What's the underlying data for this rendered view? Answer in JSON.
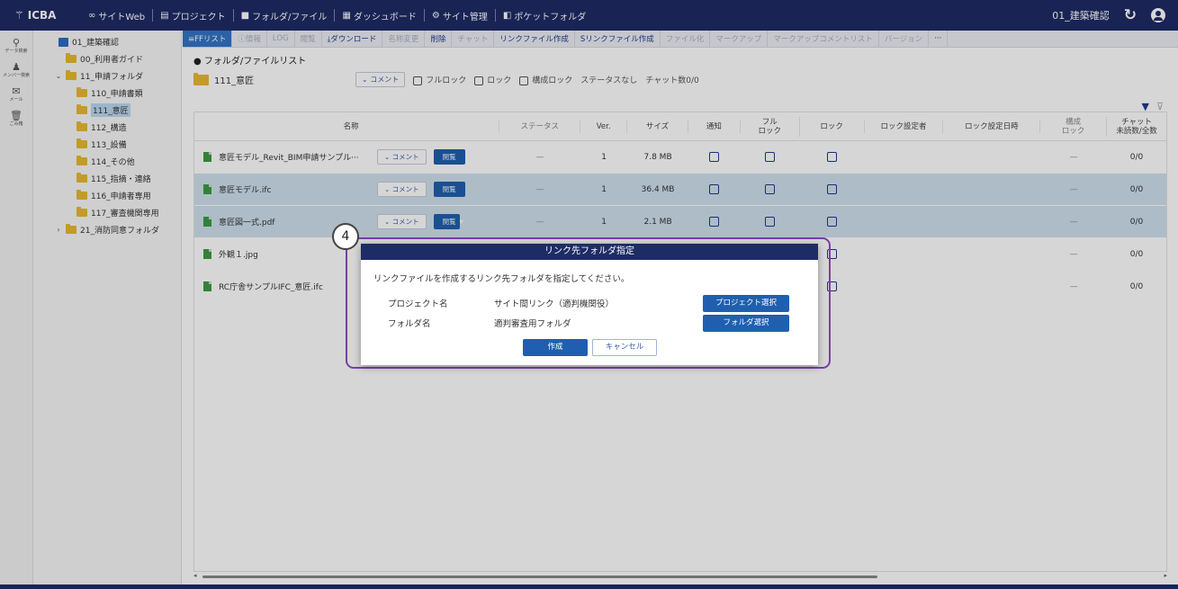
{
  "app": {
    "brand": "ICBA",
    "nav": [
      {
        "icon": "link-icon",
        "label": "サイトWeb"
      },
      {
        "icon": "project-icon",
        "label": "プロジェクト"
      },
      {
        "icon": "folder-icon",
        "label": "フォルダ/ファイル"
      },
      {
        "icon": "dashboard-icon",
        "label": "ダッシュボード"
      },
      {
        "icon": "gear-icon",
        "label": "サイト管理"
      },
      {
        "icon": "pocket-icon",
        "label": "ポケットフォルダ"
      }
    ],
    "current_project": "01_建築確認"
  },
  "rail": [
    {
      "icon": "data-search-icon",
      "label": "データ検索"
    },
    {
      "icon": "member-search-icon",
      "label": "メンバー検索"
    },
    {
      "icon": "mail-icon",
      "label": "メール"
    },
    {
      "icon": "trash-icon",
      "label": "ごみ箱"
    }
  ],
  "tree": {
    "root": "01_建築確認",
    "items": [
      {
        "label": "00_利用者ガイド",
        "level": 1,
        "caret": ""
      },
      {
        "label": "11_申請フォルダ",
        "level": 1,
        "caret": "⌄"
      },
      {
        "label": "110_申請書類",
        "level": 2,
        "caret": ""
      },
      {
        "label": "111_意匠",
        "level": 2,
        "caret": ""
      },
      {
        "label": "112_構造",
        "level": 2,
        "caret": ""
      },
      {
        "label": "113_設備",
        "level": 2,
        "caret": ""
      },
      {
        "label": "114_その他",
        "level": 2,
        "caret": ""
      },
      {
        "label": "115_指摘・連絡",
        "level": 2,
        "caret": ""
      },
      {
        "label": "116_申請者専用",
        "level": 2,
        "caret": ""
      },
      {
        "label": "117_審査機関専用",
        "level": 2,
        "caret": ""
      },
      {
        "label": "21_消防同意フォルダ",
        "level": 1,
        "caret": "›"
      }
    ]
  },
  "toolbar": [
    {
      "label": "≡FFリスト",
      "state": "active"
    },
    {
      "label": "ⓘ情報",
      "state": "disabled"
    },
    {
      "label": "LOG",
      "state": "disabled"
    },
    {
      "label": "閲覧",
      "state": "disabled"
    },
    {
      "label": "⤓ダウンロード",
      "state": "on"
    },
    {
      "label": "名称変更",
      "state": "disabled"
    },
    {
      "label": "削除",
      "state": "on"
    },
    {
      "label": "チャット",
      "state": "disabled"
    },
    {
      "label": "リンクファイル作成",
      "state": "on"
    },
    {
      "label": "Sリンクファイル作成",
      "state": "on"
    },
    {
      "label": "ファイル化",
      "state": "disabled"
    },
    {
      "label": "マークアップ",
      "state": "disabled"
    },
    {
      "label": "マークアップコメントリスト",
      "state": "disabled"
    },
    {
      "label": "バージョン",
      "state": "disabled"
    },
    {
      "label": "···",
      "state": "on"
    }
  ],
  "main": {
    "section_title": "● フォルダ/ファイルリスト",
    "folder_name": "111_意匠",
    "comment_btn": "⌄ コメント",
    "full_lock": "フルロック",
    "lock": "ロック",
    "config_lock": "構成ロック",
    "status_none": "ステータスなし",
    "chat_count": "チャット数0/0"
  },
  "table": {
    "headers": {
      "name": "名称",
      "status": "ステータス",
      "ver": "Ver.",
      "size": "サイズ",
      "notify": "通知",
      "full": "フル\nロック",
      "lock": "ロック",
      "setter": "ロック設定者",
      "date": "ロック設定日時",
      "conf": "構成\nロック",
      "chat": "チャット\n未読数/全数"
    },
    "rows": [
      {
        "name": "意匠モデル_Revit_BIM申請サンプル···",
        "comment": "⌄ コメント",
        "view": "閲覧",
        "status": "—",
        "ver": "1",
        "size": "7.8 MB",
        "conf": "—",
        "chat": "0/0",
        "selected": false,
        "view_dropdown": false
      },
      {
        "name": "意匠モデル.ifc",
        "comment": "⌄ コメント",
        "view": "閲覧",
        "status": "—",
        "ver": "1",
        "size": "36.4 MB",
        "conf": "—",
        "chat": "0/0",
        "selected": true,
        "view_dropdown": false
      },
      {
        "name": "意匠図一式.pdf",
        "comment": "⌄ コメント",
        "view": "閲覧",
        "status": "—",
        "ver": "1",
        "size": "2.1 MB",
        "conf": "—",
        "chat": "0/0",
        "selected": true,
        "view_dropdown": true
      },
      {
        "name": "外観１.jpg",
        "comment": "",
        "view": "",
        "status": "",
        "ver": "",
        "size": "",
        "conf": "—",
        "chat": "0/0",
        "selected": false,
        "view_dropdown": false
      },
      {
        "name": "RC庁舎サンプルIFC_意匠.ifc",
        "comment": "",
        "view": "",
        "status": "",
        "ver": "",
        "size": "",
        "conf": "—",
        "chat": "0/0",
        "selected": false,
        "view_dropdown": false
      }
    ]
  },
  "dialog": {
    "step": "4",
    "title": "リンク先フォルダ指定",
    "message": "リンクファイルを作成するリンク先フォルダを指定してください。",
    "project_label": "プロジェクト名",
    "project_value": "サイト間リンク（適判機関役）",
    "project_btn": "プロジェクト選択",
    "folder_label": "フォルダ名",
    "folder_value": "適判審査用フォルダ",
    "folder_btn": "フォルダ選択",
    "create_btn": "作成",
    "cancel_btn": "キャンセル"
  }
}
